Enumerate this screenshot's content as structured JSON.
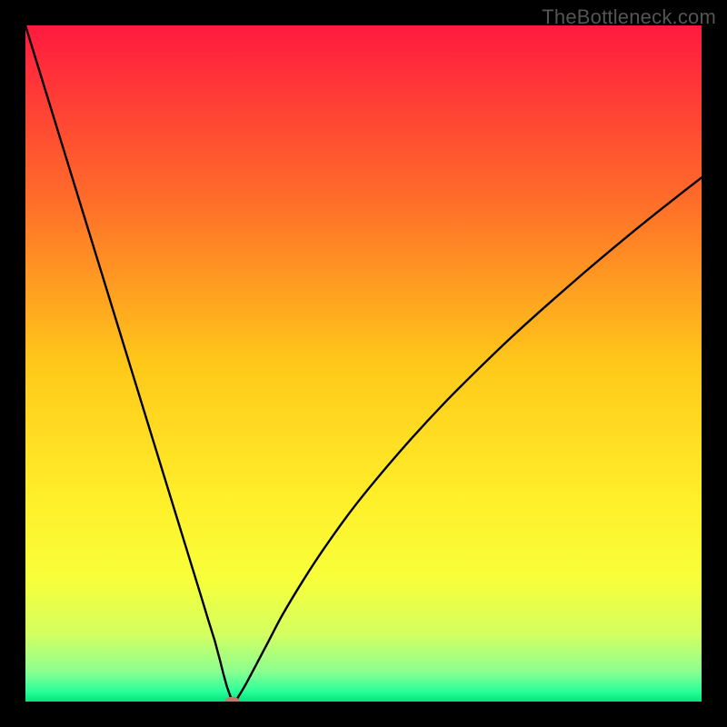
{
  "watermark": "TheBottleneck.com",
  "chart_data": {
    "type": "line",
    "title": "",
    "xlabel": "",
    "ylabel": "",
    "xlim": [
      0,
      100
    ],
    "ylim": [
      0,
      100
    ],
    "grid": false,
    "legend": false,
    "gradient_stops": [
      {
        "offset": 0.0,
        "color": "#ff1a3f"
      },
      {
        "offset": 0.25,
        "color": "#ff6a2a"
      },
      {
        "offset": 0.5,
        "color": "#ffc81a"
      },
      {
        "offset": 0.7,
        "color": "#ffef2a"
      },
      {
        "offset": 0.82,
        "color": "#f7ff3a"
      },
      {
        "offset": 0.9,
        "color": "#d4ff60"
      },
      {
        "offset": 0.955,
        "color": "#8dff90"
      },
      {
        "offset": 0.985,
        "color": "#2aff9a"
      },
      {
        "offset": 1.0,
        "color": "#00e57a"
      }
    ],
    "series": [
      {
        "name": "bottleneck-curve",
        "x": [
          0,
          2,
          4,
          6,
          8,
          10,
          12,
          14,
          16,
          18,
          20,
          22,
          24,
          26,
          27,
          28,
          28.8,
          29.3,
          29.8,
          30.3,
          30.6,
          30.6,
          31.0,
          31.6,
          32.5,
          34,
          36,
          38,
          41,
          44,
          48,
          52,
          57,
          62,
          67,
          72,
          78,
          84,
          90,
          95,
          100
        ],
        "y": [
          100,
          93.5,
          87.0,
          80.5,
          74.0,
          67.5,
          61.0,
          54.5,
          48.0,
          41.5,
          35.0,
          28.5,
          22.0,
          15.5,
          12.2,
          9.0,
          6.0,
          4.0,
          2.2,
          0.8,
          0.0,
          0.0,
          0.0,
          0.9,
          2.4,
          5.2,
          9.0,
          12.8,
          17.8,
          22.4,
          28.0,
          33.0,
          38.8,
          44.2,
          49.2,
          54.0,
          59.4,
          64.6,
          69.6,
          73.6,
          77.5
        ]
      }
    ],
    "marker": {
      "name": "optimal-point",
      "x": 30.6,
      "y": 0.0,
      "rx_pct": 1.1,
      "ry_pct": 0.7,
      "color": "#c9746a"
    }
  }
}
